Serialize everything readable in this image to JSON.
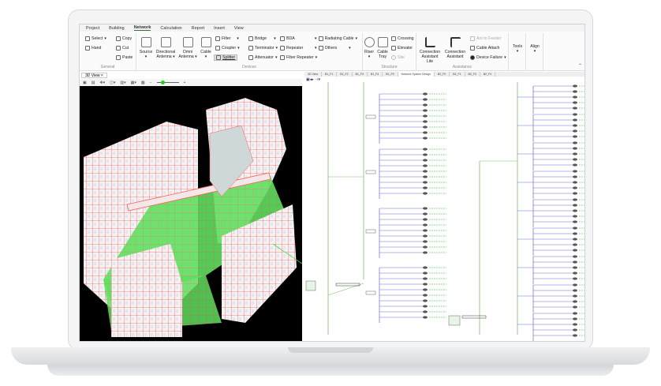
{
  "menu": [
    "Project",
    "Building",
    "Network",
    "Calculation",
    "Report",
    "Insert",
    "View"
  ],
  "active_menu": "Network",
  "ribbon": {
    "general": {
      "label": "General",
      "select": "Select",
      "hand": "Hand",
      "copy": "Copy",
      "cut": "Cut",
      "paste": "Paste"
    },
    "devices": {
      "label": "Devices",
      "source": "Source",
      "directional": "Directional Antenna",
      "omni": "Omni Antenna",
      "cable": "Cable",
      "filter": "Filter",
      "coupler": "Coupler",
      "splitter": "Splitter",
      "bridge": "Bridge",
      "terminator": "Terminator",
      "attenuator": "Attenuator",
      "bda": "BDA",
      "repeater": "Repeater",
      "fiber_repeater": "Fiber Repeater",
      "radiating_cable": "Radiating Cable",
      "others": "Others"
    },
    "structure": {
      "label": "Structure",
      "riser": "Riser",
      "cable_tray": "Cable Tray",
      "crossing": "Crossing",
      "elevator": "Elevator",
      "site": "Site"
    },
    "assistance": {
      "label": "Assistance",
      "cal": "Connection Assistant Lite",
      "ca": "Connection Assistant",
      "ant_feeder": "Ant to Feeder",
      "cable_attach": "Cable Attach",
      "device_failure": "Device Failure"
    },
    "tools": "Tools",
    "align": "Align"
  },
  "left_pane": {
    "tab": "3D View",
    "zoom_level": 0.3
  },
  "right_pane": {
    "tabs": [
      "3D View",
      "B1_F1",
      "B1_F2",
      "B1_F3",
      "B1_F4",
      "B1_F5",
      "Network System Design",
      "B2_F0",
      "B2_F1",
      "B2_F3",
      "B2_F4"
    ],
    "active_tab": "Network System Design"
  },
  "colors": {
    "accent": "#2a7a2a",
    "feeder": "#6a6ad0",
    "riser": "#7cc46a",
    "floor": "#4fd84f",
    "wall": "#ff5a5a"
  }
}
